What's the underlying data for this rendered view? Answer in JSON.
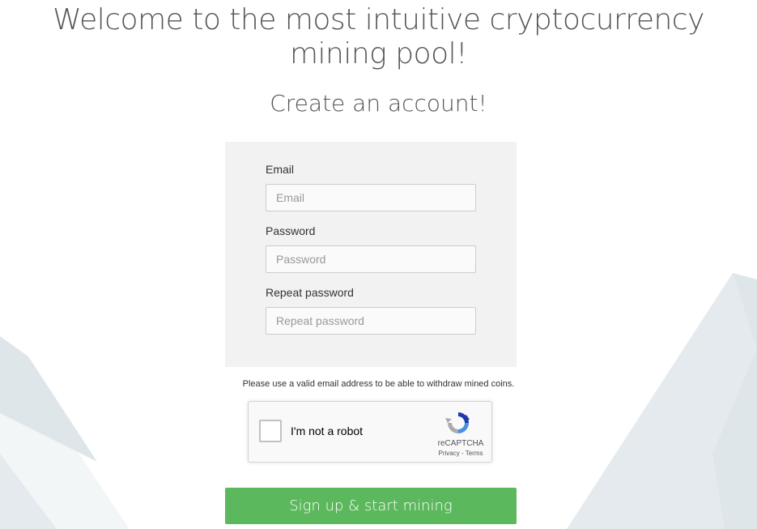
{
  "headline": {
    "line1": "Welcome to the most intuitive cryptocurrency",
    "line2": "mining pool!"
  },
  "subtitle": "Create an account!",
  "form": {
    "email": {
      "label": "Email",
      "placeholder": "Email",
      "value": ""
    },
    "password": {
      "label": "Password",
      "placeholder": "Password",
      "value": ""
    },
    "repeat_password": {
      "label": "Repeat password",
      "placeholder": "Repeat password",
      "value": ""
    }
  },
  "note": "Please use a valid email address to be able to withdraw mined coins.",
  "recaptcha": {
    "label": "I'm not a robot",
    "brand": "reCAPTCHA",
    "privacy": "Privacy",
    "separator": " - ",
    "terms": "Terms",
    "checked": false,
    "icon": "recaptcha-logo-icon"
  },
  "signup_button": {
    "label": "Sign up & start mining"
  },
  "colors": {
    "accent_green": "#5cb85c",
    "panel_bg": "#f2f2f2",
    "background_shape": "#e4eaed"
  }
}
